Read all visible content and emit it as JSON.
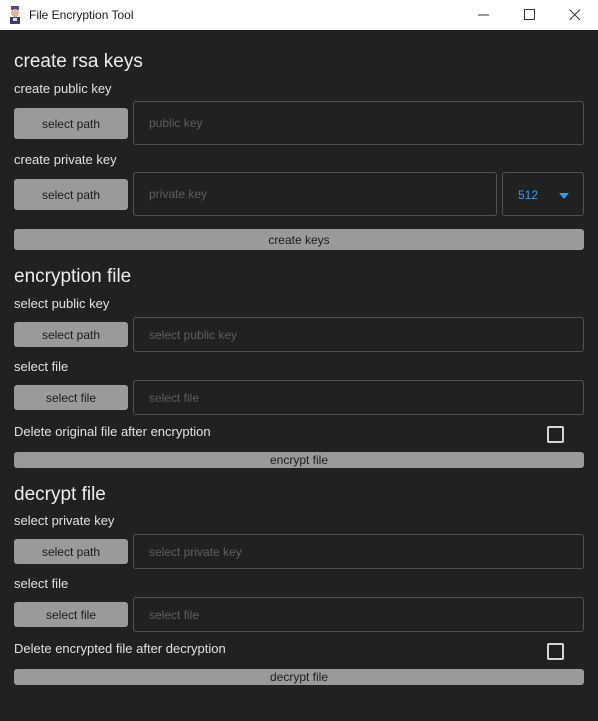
{
  "window": {
    "title": "File Encryption Tool"
  },
  "rsa_section": {
    "heading": "create rsa keys",
    "public_label": "create public key",
    "public_button": "select path",
    "public_placeholder": "public key",
    "private_label": "create private key",
    "private_button": "select path",
    "private_placeholder": "private key",
    "key_size": "512",
    "create_button": "create keys"
  },
  "encrypt_section": {
    "heading": "encryption file",
    "pubkey_label": "select public key",
    "pubkey_button": "select path",
    "pubkey_placeholder": "select public key",
    "file_label": "select file",
    "file_button": "select file",
    "file_placeholder": "select file",
    "delete_label": "Delete original file after encryption",
    "delete_checked": false,
    "action_button": "encrypt file"
  },
  "decrypt_section": {
    "heading": "decrypt file",
    "privkey_label": "select private key",
    "privkey_button": "select path",
    "privkey_placeholder": "select private key",
    "file_label": "select file",
    "file_button": "select file",
    "file_placeholder": "select file",
    "delete_label": "Delete encrypted file after decryption",
    "delete_checked": false,
    "action_button": "decrypt file"
  },
  "colors": {
    "background": "#212121",
    "button": "#9a9a9a",
    "accent": "#2f9ee8"
  },
  "icons": {
    "app": "app-icon",
    "minimize": "minimize-icon",
    "maximize": "maximize-icon",
    "close": "close-icon",
    "dropdown": "caret-down-icon"
  }
}
